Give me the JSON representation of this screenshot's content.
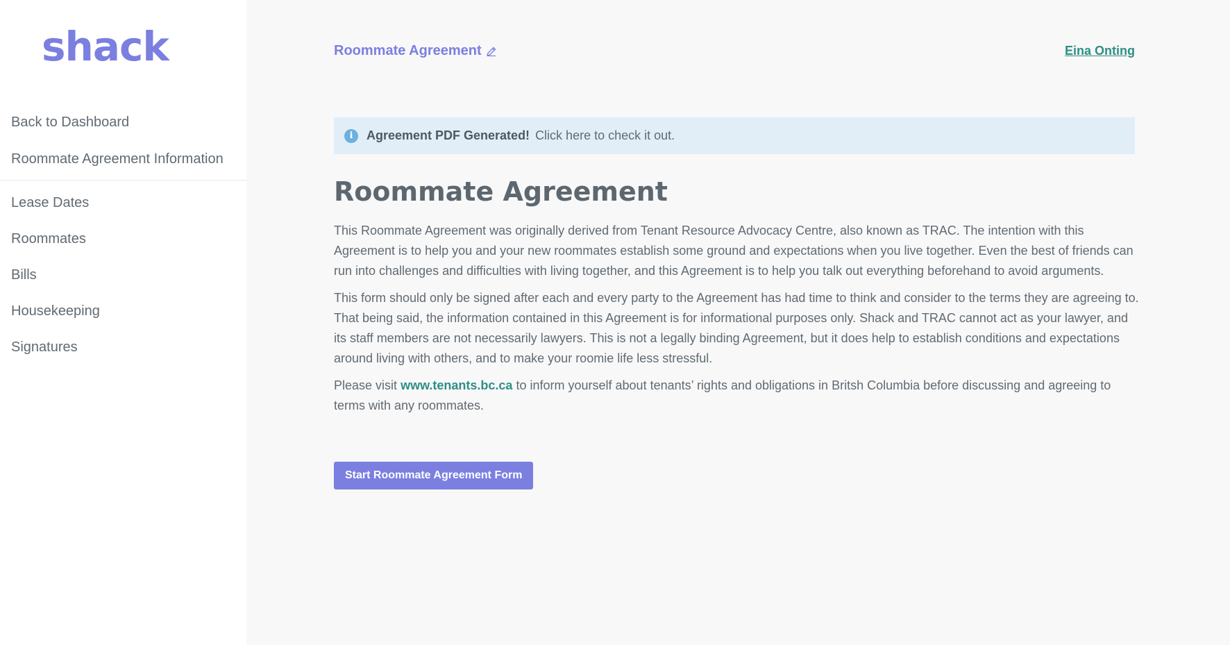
{
  "app": {
    "logo_text": "shack"
  },
  "sidebar": {
    "back_label": "Back to Dashboard",
    "info_label": "Roommate Agreement Information",
    "items": [
      {
        "label": "Lease Dates"
      },
      {
        "label": "Roommates"
      },
      {
        "label": "Bills"
      },
      {
        "label": "Housekeeping"
      },
      {
        "label": "Signatures"
      }
    ]
  },
  "header": {
    "doc_title": "Roommate Agreement",
    "edit_icon": "pencil-icon",
    "user_name": "Eina Onting"
  },
  "alert": {
    "icon": "info-icon",
    "strong": "Agreement PDF Generated!",
    "text": "Click here to check it out."
  },
  "main": {
    "title": "Roommate Agreement",
    "para1": "This Roommate Agreement was originally derived from Tenant Resource Advocacy Centre, also known as TRAC. The intention with this Agreement is to help you and your new roommates establish some ground and expectations when you live together. Even the best of friends can run into challenges and difficulties with living together, and this Agreement is to help you talk out everything beforehand to avoid arguments.",
    "para2": "This form should only be signed after each and every party to the Agreement has had time to think and consider to the terms they are agreeing to. That being said, the information contained in this Agreement is for informational purposes only. Shack and TRAC cannot act as your lawyer, and its staff members are not necessarily lawyers. This is not a legally binding Agreement, but it does help to establish conditions and expectations around living with others, and to make your roomie life less stressful.",
    "para3_before": "Please visit",
    "para3_link": "www.tenants.bc.ca",
    "para3_after": "to inform yourself about tenants’ rights and obligations in Britsh Columbia before discussing and agreeing to terms with any roommates.",
    "start_button": "Start Roommate Agreement Form"
  },
  "colors": {
    "brand": "#7b7fe0",
    "link": "#2e8f84",
    "alert_bg": "#e1eef8",
    "text": "#606a73"
  }
}
